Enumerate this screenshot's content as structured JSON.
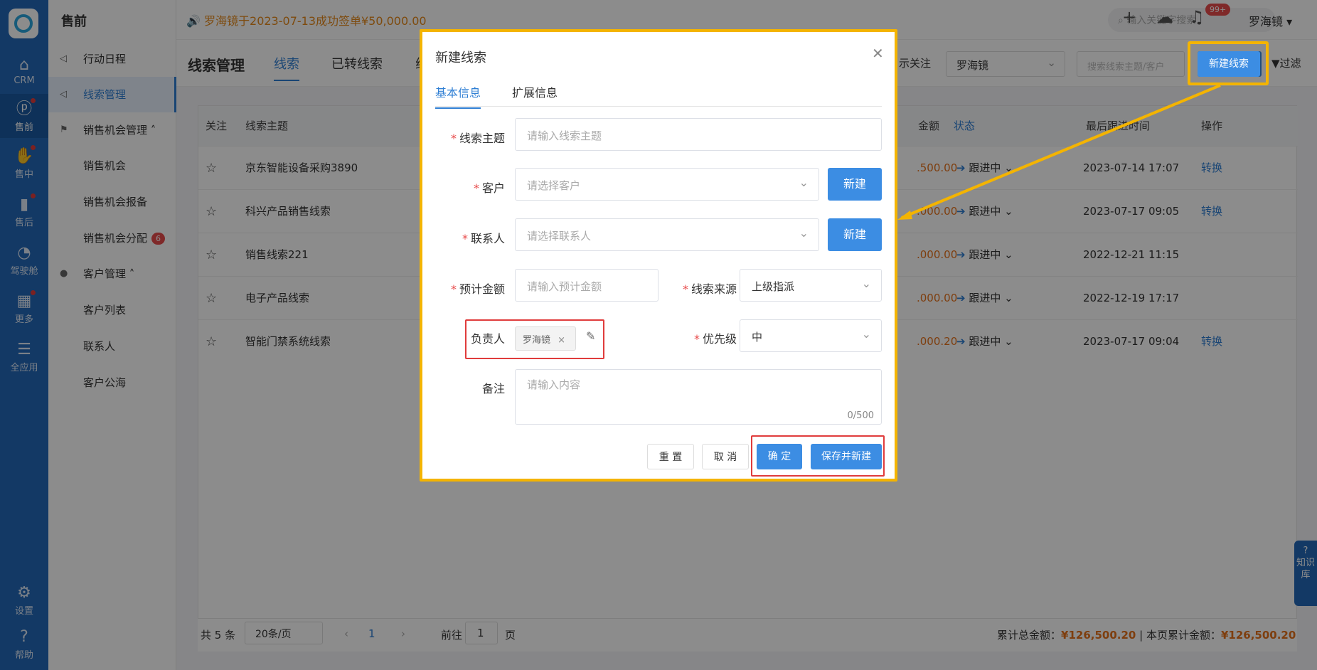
{
  "rail": {
    "items": [
      {
        "label": "CRM",
        "icon": "home-icon"
      },
      {
        "label": "售前",
        "icon": "pin-icon"
      },
      {
        "label": "售中",
        "icon": "handshake-icon"
      },
      {
        "label": "售后",
        "icon": "service-icon"
      },
      {
        "label": "驾驶舱",
        "icon": "dashboard-icon"
      },
      {
        "label": "更多",
        "icon": "grid-icon"
      },
      {
        "label": "全应用",
        "icon": "menu-icon"
      },
      {
        "label": "设置",
        "icon": "gear-icon"
      },
      {
        "label": "帮助",
        "icon": "help-icon"
      }
    ]
  },
  "menu": {
    "title": "售前",
    "items": [
      {
        "label": "行动日程"
      },
      {
        "label": "线索管理"
      },
      {
        "label": "销售机会管理"
      },
      {
        "label": "销售机会"
      },
      {
        "label": "销售机会报备"
      },
      {
        "label": "销售机会分配",
        "badge": "6"
      },
      {
        "label": "客户管理"
      },
      {
        "label": "客户列表"
      },
      {
        "label": "联系人"
      },
      {
        "label": "客户公海"
      }
    ]
  },
  "topbar": {
    "notice": "罗海镜于2023-07-13成功签单¥50,000.00",
    "search_placeholder": "输入关键字搜索",
    "bell_badge": "99+",
    "user": "罗海镜"
  },
  "header": {
    "title": "线索管理",
    "tabs": [
      "线索",
      "已转线索",
      "线"
    ],
    "display_follow": "示关注",
    "owner_select": "罗海镜",
    "search_placeholder": "搜索线索主题/客户",
    "new_button": "新建线索",
    "filter": "过滤"
  },
  "table": {
    "columns": {
      "follow": "关注",
      "subject": "线索主题",
      "amount": "金额",
      "status": "状态",
      "last_follow": "最后跟进时间",
      "action": "操作"
    },
    "rows": [
      {
        "subject": "京东智能设备采购3890",
        "amount": ".500.00",
        "status": "跟进中",
        "time": "2023-07-14 17:07",
        "action": "转换"
      },
      {
        "subject": "科兴产品销售线索",
        "amount": ".000.00",
        "status": "跟进中",
        "time": "2023-07-17 09:05",
        "action": "转换"
      },
      {
        "subject": "销售线索221",
        "amount": ".000.00",
        "status": "跟进中",
        "time": "2022-12-21 11:15",
        "action": ""
      },
      {
        "subject": "电子产品线索",
        "amount": ".000.00",
        "status": "跟进中",
        "time": "2022-12-19 17:17",
        "action": ""
      },
      {
        "subject": "智能门禁系统线索",
        "amount": ".000.20",
        "status": "跟进中",
        "time": "2023-07-17 09:04",
        "action": "转换"
      }
    ]
  },
  "pager": {
    "total": "共 5 条",
    "page_size": "20条/页",
    "current": "1",
    "goto_label": "前往",
    "goto_value": "1",
    "page_unit": "页",
    "sum_label": "累计总金额：",
    "sum_value": "¥126,500.20",
    "page_sum_label": "| 本页累计金额：",
    "page_sum_value": "¥126,500.20"
  },
  "knowledge": "知识库",
  "dialog": {
    "title": "新建线索",
    "tabs": [
      "基本信息",
      "扩展信息"
    ],
    "subject_label": "线索主题",
    "subject_placeholder": "请输入线索主题",
    "customer_label": "客户",
    "customer_placeholder": "请选择客户",
    "contact_label": "联系人",
    "contact_placeholder": "请选择联系人",
    "new_label": "新建",
    "amount_label": "预计金额",
    "amount_placeholder": "请输入预计金额",
    "source_label": "线索来源",
    "source_value": "上级指派",
    "owner_label": "负责人",
    "owner_tag": "罗海镜",
    "priority_label": "优先级",
    "priority_value": "中",
    "remark_label": "备注",
    "remark_placeholder": "请输入内容",
    "remark_count": "0/500",
    "reset": "重 置",
    "cancel": "取 消",
    "confirm": "确 定",
    "save_new": "保存并新建"
  },
  "colors": {
    "primary": "#3c8de3",
    "rail": "#2469b8",
    "highlight": "#f4b400",
    "error": "#e03c3c",
    "amount": "#e6711b"
  }
}
